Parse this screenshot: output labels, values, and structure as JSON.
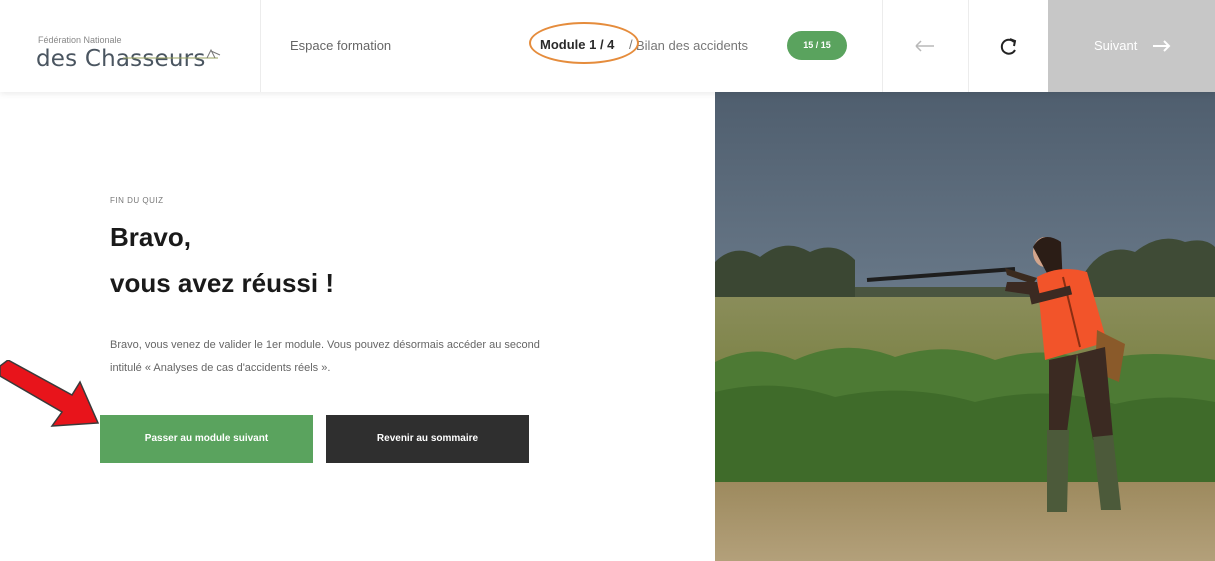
{
  "header": {
    "logo_small": "Fédération Nationale",
    "logo_main": "des Chasseurs",
    "espace": "Espace formation",
    "module": "Module 1 / 4",
    "separator": "/",
    "bilan": "Bilan des accidents",
    "badge": "15 / 15",
    "suivant": "Suivant"
  },
  "content": {
    "eyebrow": "FIN DU QUIZ",
    "title_line1": "Bravo,",
    "title_line2": "vous avez réussi !",
    "paragraph": "Bravo, vous venez de valider le 1er module. Vous pouvez désormais accéder au second intitulé « Analyses de cas d'accidents réels ».",
    "btn_next": "Passer au module suivant",
    "btn_summary": "Revenir au sommaire"
  },
  "colors": {
    "accent_green": "#5aa35e",
    "highlight": "#cdee3e",
    "annotation_orange": "#e58c3c",
    "annotation_red": "#e8141b"
  }
}
